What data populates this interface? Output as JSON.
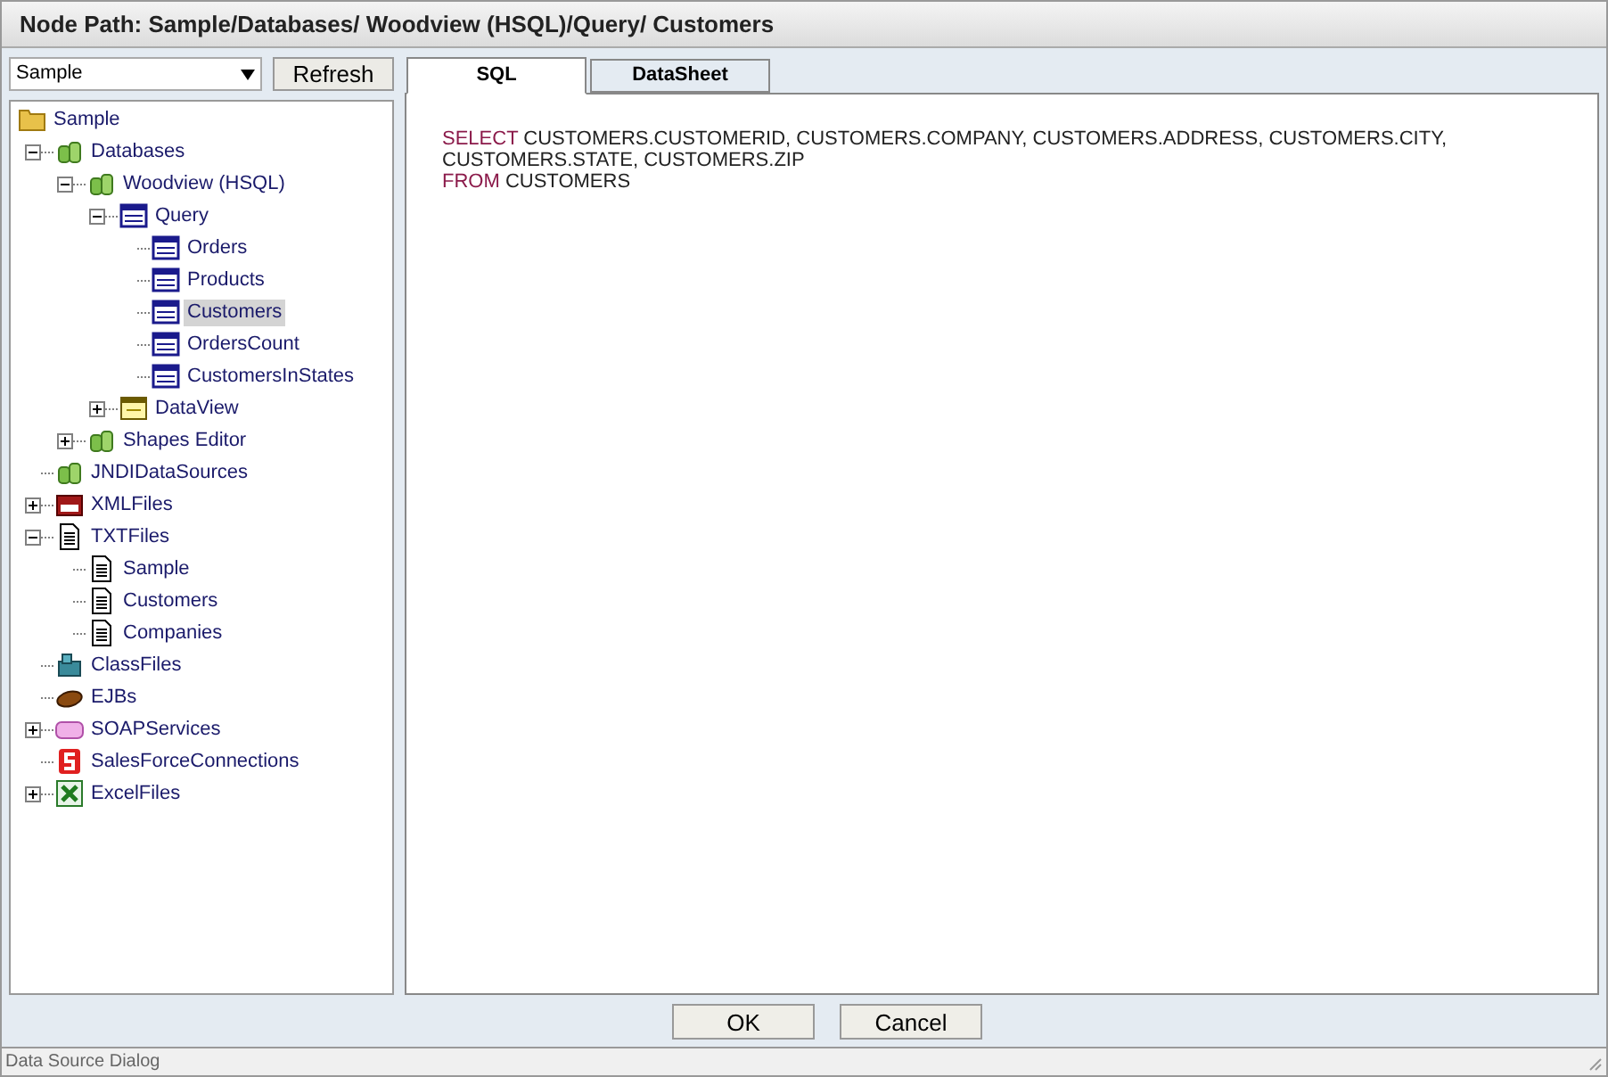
{
  "title": "Node Path: Sample/Databases/ Woodview (HSQL)/Query/ Customers",
  "source_select": {
    "value": "Sample"
  },
  "refresh_button": "Refresh",
  "tree": [
    {
      "label": "Sample",
      "kind": "folder",
      "selected": false,
      "children": [
        {
          "label": "Databases",
          "kind": "database",
          "selected": false,
          "expanded": true,
          "children": [
            {
              "label": "Woodview (HSQL)",
              "kind": "database",
              "selected": false,
              "expanded": true,
              "children": [
                {
                  "label": "Query",
                  "kind": "sql",
                  "selected": false,
                  "expanded": true,
                  "children": [
                    {
                      "label": "Orders",
                      "kind": "sql",
                      "selected": false
                    },
                    {
                      "label": "Products",
                      "kind": "sql",
                      "selected": false
                    },
                    {
                      "label": "Customers",
                      "kind": "sql",
                      "selected": true
                    },
                    {
                      "label": "OrdersCount",
                      "kind": "sql",
                      "selected": false
                    },
                    {
                      "label": "CustomersInStates",
                      "kind": "sql",
                      "selected": false
                    }
                  ]
                },
                {
                  "label": "DataView",
                  "kind": "dataview",
                  "selected": false,
                  "expanded": false
                }
              ]
            },
            {
              "label": "Shapes Editor",
              "kind": "database",
              "selected": false,
              "expanded": false
            }
          ]
        },
        {
          "label": "JNDIDataSources",
          "kind": "database",
          "selected": false
        },
        {
          "label": "XMLFiles",
          "kind": "xml",
          "selected": false,
          "expanded": false
        },
        {
          "label": "TXTFiles",
          "kind": "txt",
          "selected": false,
          "expanded": true,
          "children": [
            {
              "label": "Sample",
              "kind": "txt",
              "selected": false
            },
            {
              "label": "Customers",
              "kind": "txt",
              "selected": false
            },
            {
              "label": "Companies",
              "kind": "txt",
              "selected": false
            }
          ]
        },
        {
          "label": "ClassFiles",
          "kind": "class",
          "selected": false
        },
        {
          "label": "EJBs",
          "kind": "ejb",
          "selected": false
        },
        {
          "label": "SOAPServices",
          "kind": "soap",
          "selected": false,
          "expanded": false
        },
        {
          "label": "SalesForceConnections",
          "kind": "salesforce",
          "selected": false
        },
        {
          "label": "ExcelFiles",
          "kind": "excel",
          "selected": false,
          "expanded": false
        }
      ]
    }
  ],
  "tabs": [
    {
      "label": "SQL",
      "selected": true
    },
    {
      "label": "DataSheet",
      "selected": false
    }
  ],
  "sql_lines": [
    [
      {
        "kind": "keyword",
        "text": "SELECT"
      },
      {
        "kind": "text",
        "text": " CUSTOMERS.CUSTOMERID, CUSTOMERS.COMPANY, CUSTOMERS.ADDRESS, CUSTOMERS.CITY,"
      }
    ],
    [
      {
        "kind": "text",
        "text": "CUSTOMERS.STATE, CUSTOMERS.ZIP"
      }
    ],
    [
      {
        "kind": "keyword",
        "text": "FROM"
      },
      {
        "kind": "text",
        "text": " CUSTOMERS"
      }
    ]
  ],
  "buttons": [
    "OK",
    "Cancel"
  ],
  "status_bar": "Data Source Dialog"
}
